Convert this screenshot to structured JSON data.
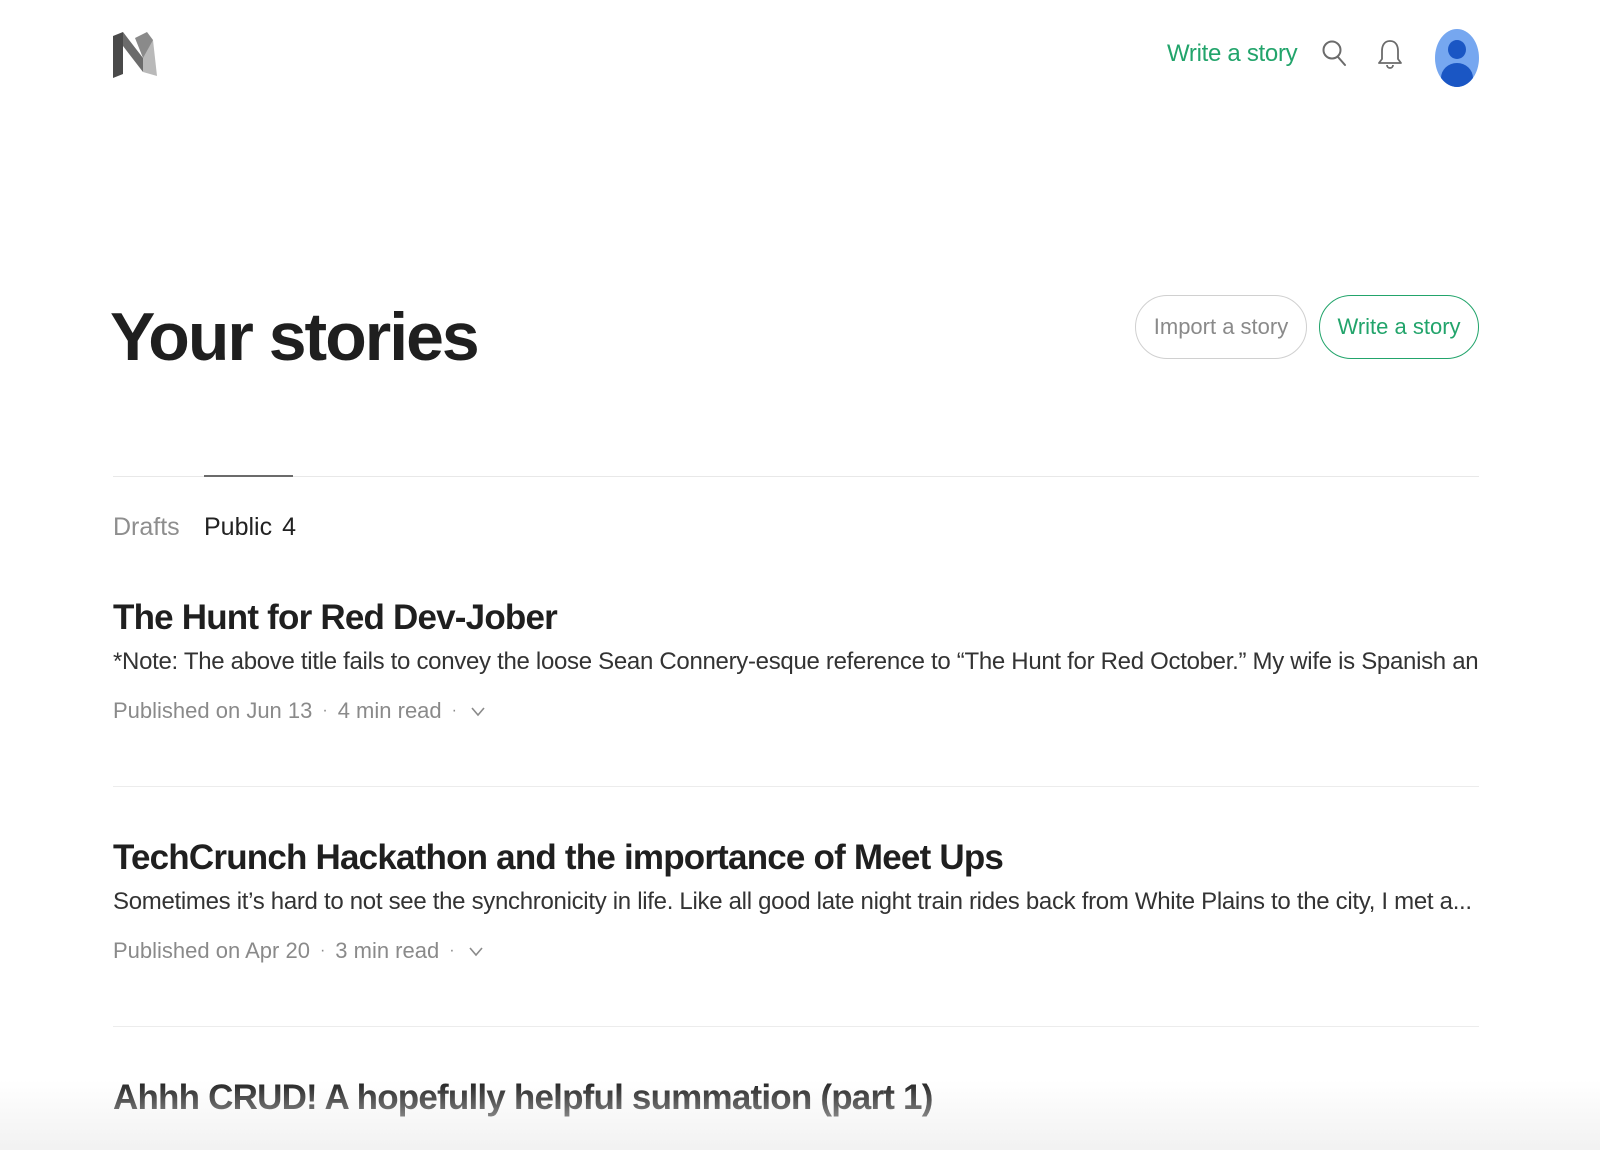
{
  "colors": {
    "accent": "#22a46b",
    "muted": "#8a8a8a",
    "avatar_bg": "#76a7f0",
    "avatar_fg": "#1a56c4"
  },
  "header": {
    "logo_icon": "medium-logo-icon",
    "write_story_link": "Write a story",
    "search_icon": "search-icon",
    "notifications_icon": "bell-icon",
    "avatar_icon": "user-avatar-icon"
  },
  "main": {
    "title": "Your stories",
    "import_button": "Import a story",
    "write_button": "Write a story",
    "tabs": [
      {
        "label": "Drafts",
        "count": ""
      },
      {
        "label": "Public",
        "count": "4"
      }
    ],
    "active_tab": "Public",
    "stories": [
      {
        "title": "The Hunt for Red Dev-Jober",
        "excerpt": "*Note: The above title fails to convey the loose Sean Connery-esque reference to “The Hunt for Red October.” My wife is Spanish and “red...",
        "published": "Published on Jun 13",
        "read_time": "4 min read"
      },
      {
        "title": "TechCrunch Hackathon and the importance of Meet Ups",
        "excerpt": "Sometimes it’s hard to not see the synchronicity in life. Like all good late night train rides back from White Plains to the city, I met a...",
        "published": "Published on Apr 20",
        "read_time": "3 min read"
      },
      {
        "title": "Ahhh CRUD! A hopefully helpful summation (part 1)",
        "excerpt": "",
        "published": "",
        "read_time": ""
      }
    ]
  }
}
